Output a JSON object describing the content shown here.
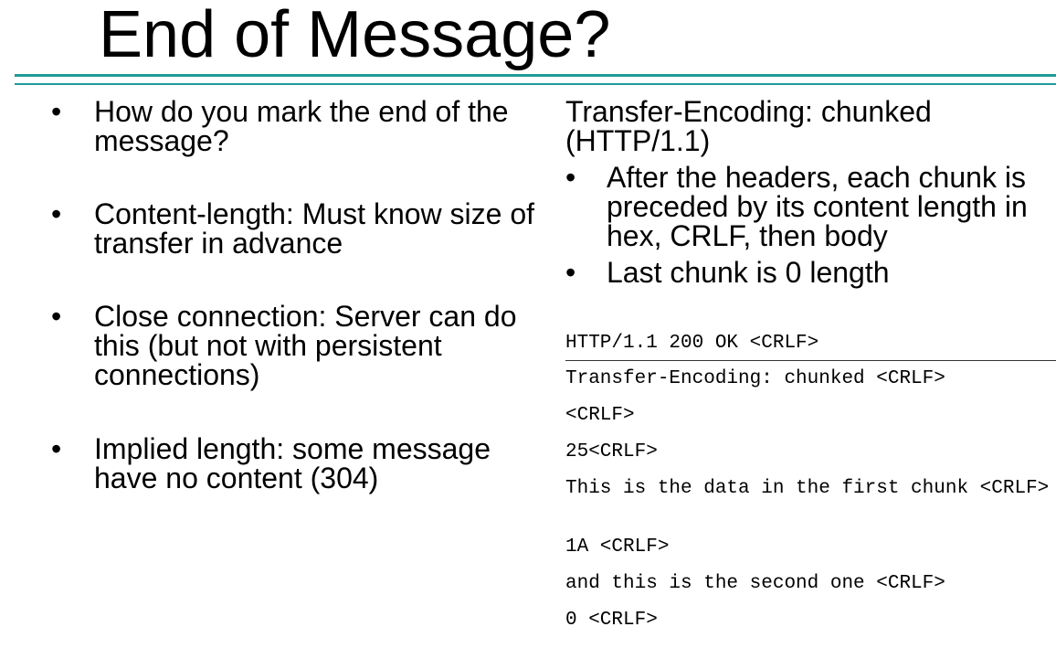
{
  "slide": {
    "title": "End of Message?"
  },
  "left": {
    "bullets": [
      {
        "text": "How do you mark the end of the message?"
      },
      {
        "text": "Content-length: Must know size of transfer in advance"
      },
      {
        "text": "Close connection: Server can do this (but not with persistent connections)"
      },
      {
        "text": "Implied length: some message have no content (304)"
      }
    ]
  },
  "right": {
    "heading": "Transfer-Encoding: chunked (HTTP/1.1)",
    "bullets": [
      {
        "text": "After the headers, each chunk is preceded by its content length in hex, CRLF, then body"
      },
      {
        "text": "Last chunk is 0 length"
      }
    ],
    "code_lines": [
      "HTTP/1.1 200 OK <CRLF>",
      "Transfer-Encoding: chunked <CRLF>",
      "<CRLF>",
      "25<CRLF>",
      "This is the data in the first chunk <CRLF>",
      "1A <CRLF>",
      "and this is the second one <CRLF>",
      "0 <CRLF>"
    ]
  },
  "symbols": {
    "bullet": "•"
  },
  "colors": {
    "accent_rule": "#1e9a9a",
    "text": "#000000",
    "background": "#ffffff"
  }
}
